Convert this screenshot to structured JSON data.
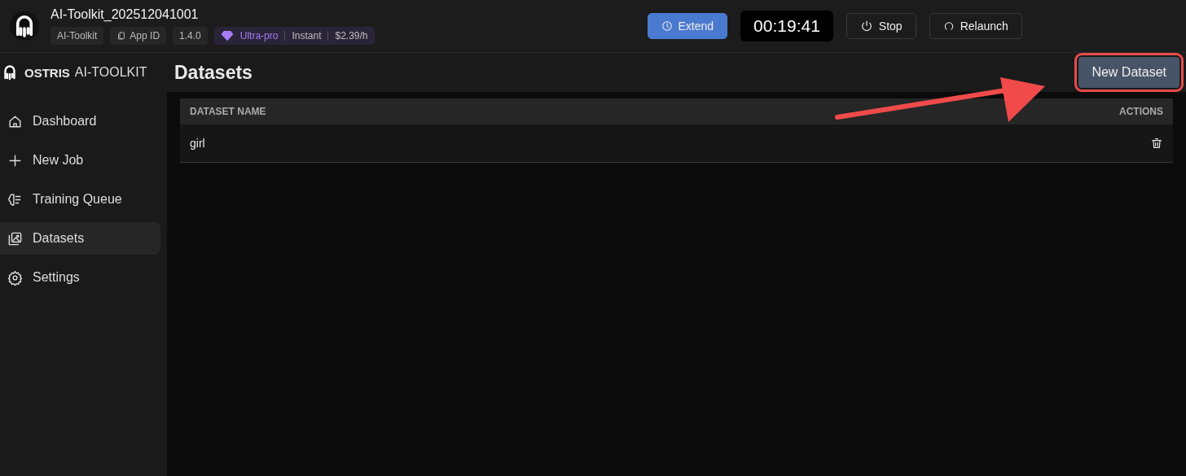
{
  "header": {
    "title": "AI-Toolkit_202512041001",
    "tags": [
      {
        "kind": "plain",
        "text": "AI-Toolkit"
      },
      {
        "kind": "appid",
        "text": "App ID"
      },
      {
        "kind": "plain",
        "text": "1.4.0"
      }
    ],
    "plan": {
      "tier": "Ultra-pro",
      "mode": "Instant",
      "price": "$2.39/h"
    },
    "extend": "Extend",
    "timer": "00:19:41",
    "stop": "Stop",
    "relaunch": "Relaunch"
  },
  "sidebar": {
    "brand": "OSTRIS",
    "product": "AI-TOOLKIT",
    "items": [
      {
        "label": "Dashboard",
        "selected": false
      },
      {
        "label": "New Job",
        "selected": false
      },
      {
        "label": "Training Queue",
        "selected": false
      },
      {
        "label": "Datasets",
        "selected": true
      },
      {
        "label": "Settings",
        "selected": false
      }
    ]
  },
  "page": {
    "title": "Datasets",
    "new_button": {
      "label": "New Dataset",
      "highlighted": true
    },
    "annotation_arrow": true
  },
  "table": {
    "columns": [
      "DATASET NAME",
      "ACTIONS"
    ],
    "rows": [
      {
        "name": "girl"
      }
    ]
  }
}
